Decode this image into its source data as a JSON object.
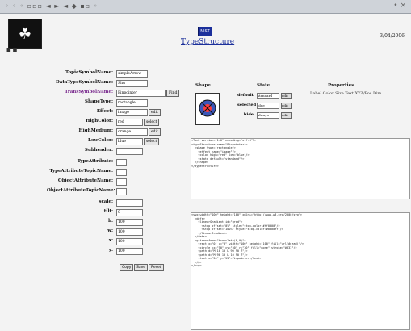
{
  "window": {
    "toolbar_icons": "◦ ◦ ◦ ▫▫▫ ◄ ► ◄ ◆ ▪▫ ◦",
    "right_controls": "• ×"
  },
  "header": {
    "brand": "NIST",
    "title": "TypeStructure",
    "date": "3/04/2006"
  },
  "form": {
    "rows": [
      {
        "label": "TopicSymbolName:",
        "value": "simpleArrow",
        "control": "select"
      },
      {
        "label": "DataTypeSymbolName:",
        "value": "Shu",
        "control": "select"
      },
      {
        "label": "TransSymbolName:",
        "value": "Pinpointer",
        "control": "input",
        "link": true,
        "button": "Find"
      },
      {
        "label": "ShapeType:",
        "value": "rectangle",
        "control": "select"
      },
      {
        "label": "Effect:",
        "value": "image",
        "control": "select",
        "button": "edit"
      },
      {
        "label": "HighColor:",
        "value": "red",
        "control": "input",
        "button": "select"
      },
      {
        "label": "HighMedium:",
        "value": "orange",
        "control": "select",
        "button": "edit"
      },
      {
        "label": "LowColor:",
        "value": "blue",
        "control": "input",
        "button": "select"
      },
      {
        "label": "Subheader:",
        "value": "",
        "control": "input"
      },
      {
        "label": "TypeAttribute:",
        "value": "",
        "control": "select"
      },
      {
        "label": "TypeAttributeTopicName:",
        "value": "",
        "control": "select"
      },
      {
        "label": "ObjectAttributeName:",
        "value": "",
        "control": "select"
      },
      {
        "label": "ObjectAttributeTopicName:",
        "value": "",
        "control": "select"
      },
      {
        "label": "scale:",
        "value": "",
        "control": "input"
      },
      {
        "label": "tilt:",
        "value": "0",
        "control": "input"
      },
      {
        "label": "h:",
        "value": "100",
        "control": "input"
      },
      {
        "label": "w:",
        "value": "100",
        "control": "input"
      },
      {
        "label": "x:",
        "value": "100",
        "control": "input"
      },
      {
        "label": "y:",
        "value": "100",
        "control": "input"
      }
    ],
    "actions": [
      "Copy",
      "Save",
      "Reset"
    ]
  },
  "table": {
    "col_shape": "Shape",
    "col_state": "State",
    "col_props": "Properties",
    "props_text": "Label  Color  Size  Text  XYZ/Pos  Dim",
    "states": [
      {
        "label": "default",
        "value": "standard",
        "btn": "edit"
      },
      {
        "label": "selected",
        "value": "blue",
        "btn": "edit"
      },
      {
        "label": "hide",
        "value": "always",
        "btn": "edit"
      }
    ]
  },
  "code": {
    "top": "<?xml version=\"1.0\" encoding=\"utf-8\"?>\n<typeStructure name=\"Pinpointer\">\n  <shape type=\"rectangle\">\n    <effect name=\"image\"/>\n    <color high=\"red\" low=\"blue\"/>\n    <state default=\"standard\"/>\n  </shape>\n</typeStructure>",
    "bottom": "<svg width=\"100\" height=\"100\" xmlns=\"http://www.w3.org/2000/svg\">\n  <defs>\n    <linearGradient id=\"grad\">\n      <stop offset=\"0%\" style=\"stop-color:#ff0000\"/>\n      <stop offset=\"100%\" style=\"stop-color:#0000ff\"/>\n    </linearGradient>\n  </defs>\n  <g transform=\"translate(0,0)\">\n    <rect x=\"0\" y=\"0\" width=\"100\" height=\"100\" fill=\"url(#grad)\"/>\n    <circle cx=\"50\" cy=\"50\" r=\"30\" fill=\"none\" stroke=\"#333\"/>\n    <path d=\"M 10 10 L 90 90 Z\"/>\n    <path d=\"M 90 10 L 10 90 Z\"/>\n    <text x=\"50\" y=\"55\">Pinpointer</text>\n  </g>\n</svg>"
  }
}
